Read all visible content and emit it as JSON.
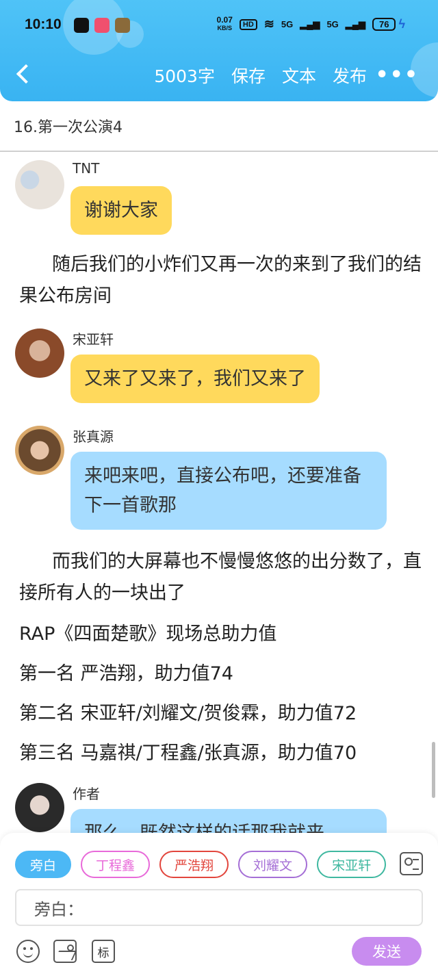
{
  "status_bar": {
    "time": "10:10",
    "speed_value": "0.07",
    "speed_unit": "KB/S",
    "hd_label": "HD",
    "signal_1": "5G",
    "signal_2": "5G",
    "battery": "76"
  },
  "nav": {
    "word_count": "5003字",
    "save_label": "保存",
    "text_label": "文本",
    "publish_label": "发布",
    "more_label": "•••"
  },
  "chapter_title": "16.第一次公演4",
  "messages": [
    {
      "speaker": "TNT",
      "text": "谢谢大家"
    },
    {
      "speaker": "宋亚轩",
      "text": "又来了又来了，我们又来了"
    },
    {
      "speaker": "张真源",
      "text": "来吧来吧，直接公布吧，还要准备下一首歌那"
    },
    {
      "speaker": "作者",
      "text": "那么，既然这样的话那我就来"
    }
  ],
  "narration": {
    "para1": "随后我们的小炸们又再一次的来到了我们的结果公布房间",
    "para2": "而我们的大屏幕也不慢慢悠悠的出分数了，直接所有人的一块出了",
    "line1": "RAP《四面楚歌》现场总助力值",
    "line2": "第一名 严浩翔，助力值74",
    "line3": "第二名 宋亚轩/刘耀文/贺俊霖，助力值72",
    "line4": "第三名 马嘉祺/丁程鑫/张真源，助力值70"
  },
  "bottom": {
    "chips": [
      {
        "label": "旁白",
        "color": "#4cb8f5"
      },
      {
        "label": "丁程鑫",
        "color": "#e86ad9"
      },
      {
        "label": "严浩翔",
        "color": "#e2453c"
      },
      {
        "label": "刘耀文",
        "color": "#a56fd6"
      },
      {
        "label": "宋亚轩",
        "color": "#3fb8a0"
      }
    ],
    "input_value": "旁白：",
    "mark_label": "标",
    "send_label": "发送"
  },
  "colors": {
    "header": "#4fc3f7",
    "bubble_yellow": "#ffd95c",
    "bubble_blue": "#a6dcff",
    "send": "#c88cef"
  },
  "icons": [
    "back-icon",
    "more-icon",
    "contact-card-icon",
    "emoji-icon",
    "image-icon",
    "mark-icon"
  ]
}
